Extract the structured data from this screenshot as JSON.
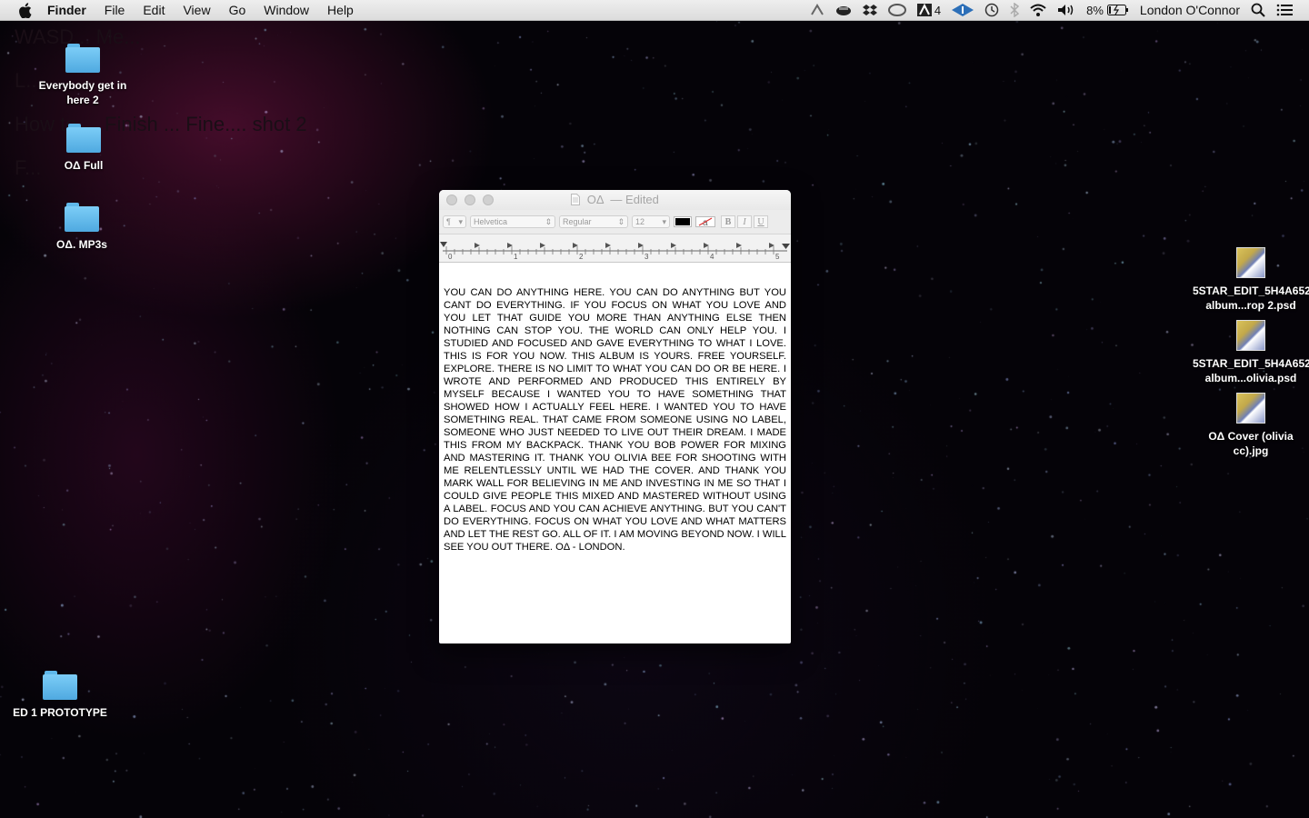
{
  "menubar": {
    "app_name": "Finder",
    "menus": [
      "File",
      "Edit",
      "View",
      "Go",
      "Window",
      "Help"
    ],
    "status": {
      "adobe_count": "4",
      "battery": "8%",
      "user": "London O'Connor"
    }
  },
  "desktop": {
    "ghost_lines": [
      "WASD... Me...",
      "L...",
      "How to ... Finish ... Fine.... shot 2",
      "F..."
    ],
    "left_icons": [
      {
        "label": "Everybody get in here 2",
        "kind": "folder"
      },
      {
        "label": "OΔ Full",
        "kind": "folder"
      },
      {
        "label": "OΔ. MP3s",
        "kind": "folder"
      },
      {
        "label": "ED 1 PROTOTYPE",
        "kind": "folder"
      }
    ],
    "right_icons": [
      {
        "label": "5STAR_EDIT_5H4A6525 album...rop 2.psd",
        "kind": "image"
      },
      {
        "label": "5STAR_EDIT_5H4A6525 album...olivia.psd",
        "kind": "image"
      },
      {
        "label": "OΔ Cover (olivia cc).jpg",
        "kind": "image"
      }
    ]
  },
  "window": {
    "title": "OΔ",
    "status": "— Edited",
    "toolbar": {
      "paragraph": "¶",
      "font": "Helvetica",
      "style": "Regular",
      "size": "12",
      "bold": "B",
      "italic": "I",
      "underline": "U",
      "text_color": "#000000"
    },
    "ruler_labels": [
      "0",
      "1",
      "2",
      "3",
      "4",
      "5"
    ],
    "document_text": "YOU CAN DO ANYTHING HERE.  YOU CAN DO ANYTHING BUT YOU CANT DO EVERYTHING.  IF YOU FOCUS ON WHAT YOU LOVE AND YOU LET THAT GUIDE YOU MORE THAN ANYTHING ELSE THEN NOTHING CAN STOP YOU.  THE WORLD CAN ONLY HELP YOU.  I STUDIED AND FOCUSED AND GAVE EVERYTHING TO WHAT I LOVE.  THIS IS FOR YOU NOW.  THIS ALBUM IS YOURS.  FREE YOURSELF.  EXPLORE.  THERE IS NO LIMIT TO WHAT YOU CAN DO OR BE HERE.  I WROTE AND PERFORMED AND PRODUCED THIS ENTIRELY BY MYSELF BECAUSE I WANTED YOU TO HAVE SOMETHING THAT SHOWED HOW I ACTUALLY FEEL HERE.  I WANTED YOU TO HAVE SOMETHING REAL. THAT CAME FROM SOMEONE USING NO LABEL, SOMEONE WHO JUST NEEDED TO LIVE OUT THEIR DREAM.  I MADE THIS FROM MY BACKPACK.  THANK YOU BOB POWER FOR MIXING AND MASTERING IT.  THANK YOU OLIVIA BEE FOR SHOOTING WITH ME RELENTLESSLY UNTIL WE HAD THE COVER.  AND THANK YOU MARK WALL FOR BELIEVING IN ME AND INVESTING IN ME SO THAT I COULD GIVE PEOPLE THIS MIXED AND MASTERED WITHOUT USING A LABEL.  FOCUS AND YOU CAN ACHIEVE ANYTHING.   BUT YOU CAN'T DO EVERYTHING.   FOCUS ON WHAT YOU LOVE AND WHAT MATTERS AND LET THE REST GO.  ALL OF IT.  I AM MOVING BEYOND NOW.  I WILL SEE YOU OUT THERE.  OΔ - LONDON."
  }
}
